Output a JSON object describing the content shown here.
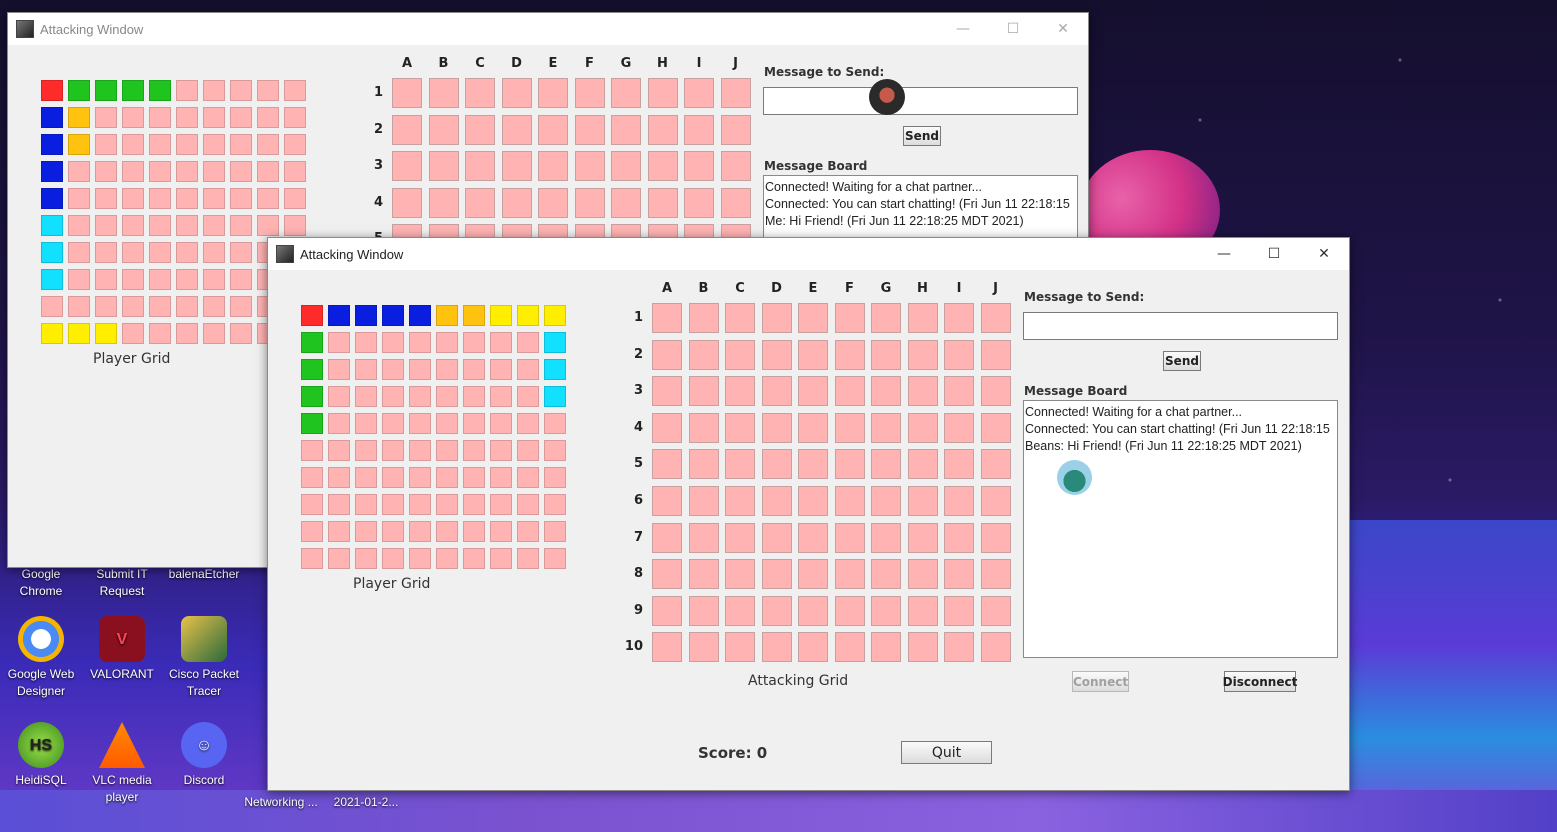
{
  "desktop": {
    "icons": [
      {
        "label": "Google Chrome"
      },
      {
        "label": "Submit IT Request"
      },
      {
        "label": "balenaEtcher"
      },
      {
        "label": "Google Web Designer"
      },
      {
        "label": "VALORANT"
      },
      {
        "label": "Cisco Packet Tracer"
      },
      {
        "label": "HeidiSQL",
        "glyph": "HS"
      },
      {
        "label": "VLC media player"
      },
      {
        "label": "Discord"
      },
      {
        "label": "Networking ..."
      },
      {
        "label": "2021-01-2..."
      }
    ]
  },
  "colors": {
    "empty": "#ffb3b3",
    "red": "#ff2b2b",
    "green": "#1fc41f",
    "blue": "#0a1ee0",
    "orange": "#ffc20e",
    "yellow": "#ffee00",
    "cyan": "#11e0ff"
  },
  "back_window": {
    "title": "Attacking Window",
    "minimize": "—",
    "maximize": "☐",
    "close": "✕",
    "player_grid_caption": "Player Grid",
    "player_grid": [
      [
        "red",
        "green",
        "green",
        "green",
        "green",
        "",
        "",
        "",
        "",
        ""
      ],
      [
        "blue",
        "orange",
        "",
        "",
        "",
        "",
        "",
        "",
        "",
        ""
      ],
      [
        "blue",
        "orange",
        "",
        "",
        "",
        "",
        "",
        "",
        "",
        ""
      ],
      [
        "blue",
        "",
        "",
        "",
        "",
        "",
        "",
        "",
        "",
        ""
      ],
      [
        "blue",
        "",
        "",
        "",
        "",
        "",
        "",
        "",
        "",
        ""
      ],
      [
        "cyan",
        "",
        "",
        "",
        "",
        "",
        "",
        "",
        "",
        ""
      ],
      [
        "cyan",
        "",
        "",
        "",
        "",
        "",
        "",
        "",
        "",
        ""
      ],
      [
        "cyan",
        "",
        "",
        "",
        "",
        "",
        "",
        "",
        "",
        ""
      ],
      [
        "",
        "",
        "",
        "",
        "",
        "",
        "",
        "",
        "",
        ""
      ],
      [
        "yellow",
        "yellow",
        "yellow",
        "",
        "",
        "",
        "",
        "",
        "",
        ""
      ]
    ],
    "col_headers": [
      "A",
      "B",
      "C",
      "D",
      "E",
      "F",
      "G",
      "H",
      "I",
      "J"
    ],
    "row_headers": [
      "1",
      "2",
      "3",
      "4",
      "5"
    ],
    "message_label": "Message to Send:",
    "send": "Send",
    "board_label": "Message Board",
    "messages": [
      "Connected! Waiting for a chat partner...",
      "Connected: You can start chatting! (Fri Jun 11 22:18:15",
      "Me: Hi Friend! (Fri Jun 11 22:18:25 MDT 2021)"
    ]
  },
  "front_window": {
    "title": "Attacking Window",
    "minimize": "—",
    "maximize": "☐",
    "close": "✕",
    "player_grid_caption": "Player Grid",
    "player_grid": [
      [
        "red",
        "blue",
        "blue",
        "blue",
        "blue",
        "orange",
        "orange",
        "yellow",
        "yellow",
        "yellow"
      ],
      [
        "green",
        "",
        "",
        "",
        "",
        "",
        "",
        "",
        "",
        "cyan"
      ],
      [
        "green",
        "",
        "",
        "",
        "",
        "",
        "",
        "",
        "",
        "cyan"
      ],
      [
        "green",
        "",
        "",
        "",
        "",
        "",
        "",
        "",
        "",
        "cyan"
      ],
      [
        "green",
        "",
        "",
        "",
        "",
        "",
        "",
        "",
        "",
        ""
      ],
      [
        "",
        "",
        "",
        "",
        "",
        "",
        "",
        "",
        "",
        ""
      ],
      [
        "",
        "",
        "",
        "",
        "",
        "",
        "",
        "",
        "",
        ""
      ],
      [
        "",
        "",
        "",
        "",
        "",
        "",
        "",
        "",
        "",
        ""
      ],
      [
        "",
        "",
        "",
        "",
        "",
        "",
        "",
        "",
        "",
        ""
      ],
      [
        "",
        "",
        "",
        "",
        "",
        "",
        "",
        "",
        "",
        ""
      ]
    ],
    "col_headers": [
      "A",
      "B",
      "C",
      "D",
      "E",
      "F",
      "G",
      "H",
      "I",
      "J"
    ],
    "row_headers": [
      "1",
      "2",
      "3",
      "4",
      "5",
      "6",
      "7",
      "8",
      "9",
      "10"
    ],
    "attacking_grid_caption": "Attacking Grid",
    "message_label": "Message to Send:",
    "message_value": "",
    "send": "Send",
    "board_label": "Message Board",
    "messages": [
      "Connected! Waiting for a chat partner...",
      "Connected: You can start chatting! (Fri Jun 11 22:18:15",
      "Beans: Hi Friend! (Fri Jun 11 22:18:25 MDT 2021)"
    ],
    "connect": "Connect",
    "disconnect": "Disconnect",
    "score": "Score: 0",
    "quit": "Quit"
  }
}
